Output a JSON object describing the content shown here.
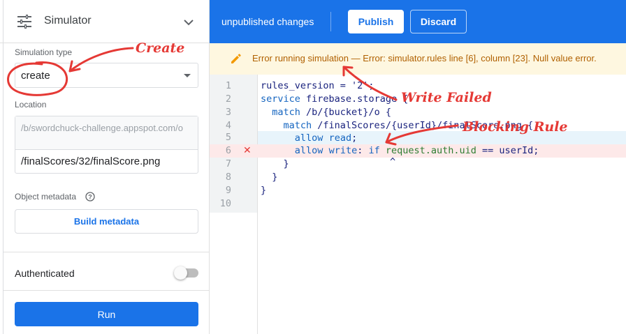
{
  "simulator": {
    "title": "Simulator",
    "simulation_type_label": "Simulation type",
    "simulation_type_value": "create",
    "location_label": "Location",
    "location_prefix": "/b/swordchuck-challenge.appspot.com/o",
    "location_path": "/finalScores/32/finalScore.png",
    "object_metadata_label": "Object metadata",
    "build_metadata_label": "Build metadata",
    "authenticated_label": "Authenticated",
    "authenticated": false,
    "run_label": "Run"
  },
  "topbar": {
    "status": "unpublished changes",
    "publish_label": "Publish",
    "discard_label": "Discard"
  },
  "error": {
    "message": "Error running simulation — Error: simulator.rules line [6], column [23]. Null value error."
  },
  "editor": {
    "lines": [
      {
        "num": "1",
        "code": "rules_version = '2';"
      },
      {
        "num": "2",
        "code": "service firebase.storage {"
      },
      {
        "num": "3",
        "code": "  match /b/{bucket}/o {"
      },
      {
        "num": "4",
        "code": "    match /finalScores/{userId}/finalScore.png {"
      },
      {
        "num": "5",
        "code": "      allow read;"
      },
      {
        "num": "6",
        "code": "      allow write: if request.auth.uid == userId;"
      },
      {
        "num": "7",
        "code": "    }"
      },
      {
        "num": "8",
        "code": "  }"
      },
      {
        "num": "9",
        "code": "}"
      },
      {
        "num": "10",
        "code": ""
      }
    ],
    "error_line": 6,
    "highlight_line": 5,
    "error_caret": "^"
  },
  "annotations": {
    "create": "Create",
    "write_failed": "Write Failed",
    "blocking_rule": "Blocking Rule"
  },
  "colors": {
    "primary": "#1a73e8",
    "error_text": "#b06000",
    "error_banner_bg": "#fef7e0",
    "annotation_red": "#e53935"
  },
  "icons": {
    "header": "tune-icon",
    "collapse": "chevron-down-icon",
    "help": "help-circle-icon",
    "error": "pencil-icon",
    "error_line_marker": "close-icon"
  }
}
